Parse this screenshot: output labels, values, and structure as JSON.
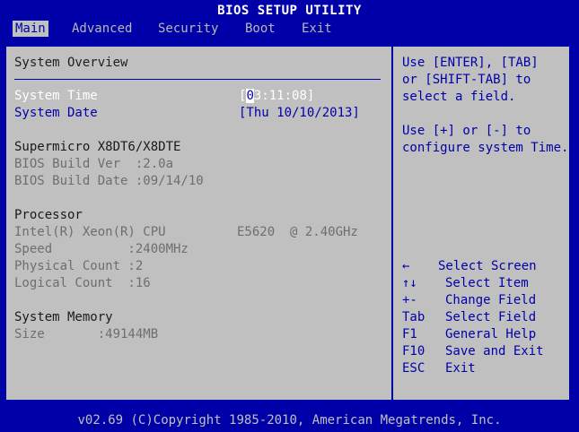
{
  "window": {
    "title": "BIOS SETUP UTILITY"
  },
  "menu": [
    "Main",
    "Advanced",
    "Security",
    "Boot",
    "Exit"
  ],
  "overview": {
    "heading": "System Overview",
    "system_time_label": "System Time",
    "system_time_open": "[",
    "system_time_cursor": "0",
    "system_time_rest": "3:11:08]",
    "system_date_label": "System Date",
    "system_date_value": "[Thu 10/10/2013]"
  },
  "board": {
    "title": "Supermicro X8DT6/X8DTE",
    "bios_build_ver": "BIOS Build Ver  :2.0a",
    "bios_build_date": "BIOS Build Date :09/14/10"
  },
  "processor": {
    "title": "Processor",
    "cpu_name": "Intel(R) Xeon(R) CPU",
    "cpu_model": "E5620  @ 2.40GHz",
    "speed": "Speed          :2400MHz",
    "physical_count": "Physical Count :2",
    "logical_count": "Logical Count  :16"
  },
  "memory": {
    "title": "System Memory",
    "size": "Size       :49144MB"
  },
  "help": {
    "line1": "Use [ENTER], [TAB]",
    "line2": "or [SHIFT-TAB] to",
    "line3": "select a field.",
    "line4": "Use [+] or [-] to",
    "line5": "configure system Time."
  },
  "keys": [
    {
      "key": "←",
      "desc": "Select Screen"
    },
    {
      "key": "↑↓",
      "desc": "Select Item"
    },
    {
      "key": "+-",
      "desc": "Change Field"
    },
    {
      "key": "Tab",
      "desc": "Select Field"
    },
    {
      "key": "F1",
      "desc": "General Help"
    },
    {
      "key": "F10",
      "desc": "Save and Exit"
    },
    {
      "key": "ESC",
      "desc": "Exit"
    }
  ],
  "footer": {
    "text": "v02.69 (C)Copyright 1985-2010, American Megatrends, Inc."
  }
}
